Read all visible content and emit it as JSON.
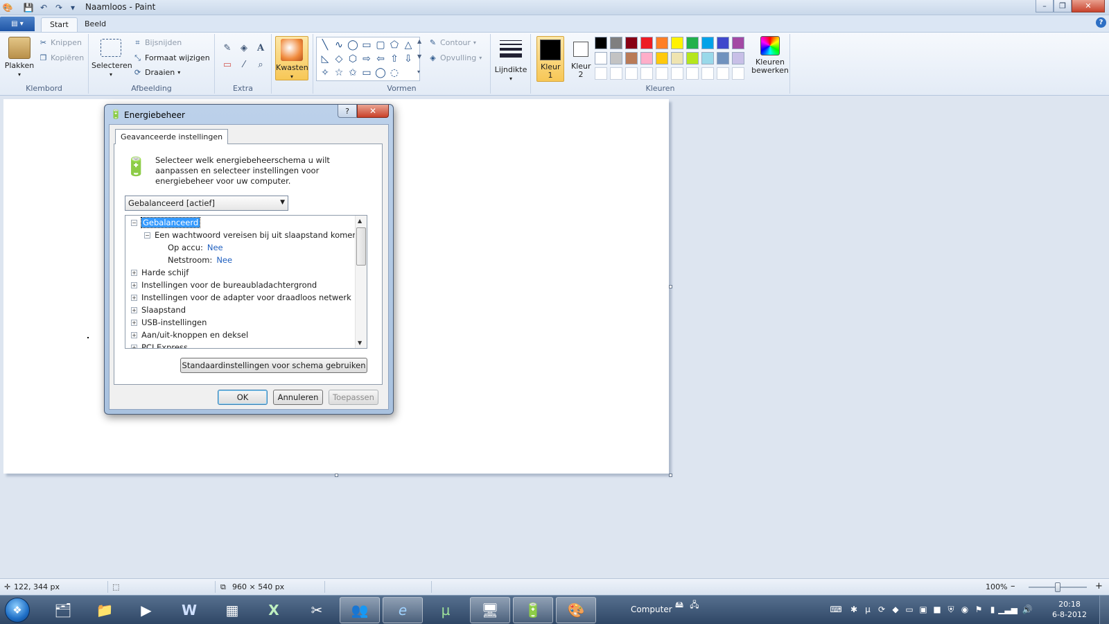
{
  "window": {
    "title": "Naamloos - Paint",
    "min": "–",
    "max": "❐",
    "close": "✕"
  },
  "qat": {
    "save": "💾",
    "undo": "↶",
    "redo": "↷",
    "more": "▾"
  },
  "tabs": {
    "app_menu": "▤ ▾",
    "start": "Start",
    "beeld": "Beeld",
    "help": "?"
  },
  "ribbon": {
    "klembord": {
      "label": "Klembord",
      "paste": "Plakken",
      "cut": "Knippen",
      "copy": "Kopiëren"
    },
    "afbeelding": {
      "label": "Afbeelding",
      "select": "Selecteren",
      "crop": "Bijsnijden",
      "resize": "Formaat wijzigen",
      "rotate": "Draaien"
    },
    "extra": {
      "label": "Extra",
      "pencil": "✎",
      "fill": "◈",
      "text": "A",
      "eraser": "▭",
      "picker": "⁄",
      "magnifier": "⌕"
    },
    "kwasten": {
      "label": "Kwasten"
    },
    "vormen": {
      "label": "Vormen",
      "contour": "Contour",
      "fill": "Opvulling",
      "shapes": [
        "╲",
        "∿",
        "◯",
        "▭",
        "▢",
        "⬠",
        "△",
        "◺",
        "◇",
        "⬡",
        "⇨",
        "⇦",
        "⇧",
        "⇩",
        "✧",
        "☆",
        "✩",
        "▭",
        "◯",
        "◌"
      ]
    },
    "lijndikte": {
      "label": "Lijndikte"
    },
    "kleuren": {
      "label": "Kleuren",
      "color1": "Kleur 1",
      "color2": "Kleur 2",
      "edit": "Kleuren bewerken",
      "palette_row1": [
        "#000000",
        "#7f7f7f",
        "#880015",
        "#ed1c24",
        "#ff7f27",
        "#fff200",
        "#22b14c",
        "#00a2e8",
        "#3f48cc",
        "#a349a4"
      ],
      "palette_row2": [
        "#ffffff",
        "#c3c3c3",
        "#b97a57",
        "#ffaec9",
        "#ffc90e",
        "#efe4b0",
        "#b5e61d",
        "#99d9ea",
        "#7092be",
        "#c8bfe7"
      ],
      "color1_value": "#000000",
      "color2_value": "#ffffff"
    }
  },
  "dialog": {
    "title": "Energiebeheer",
    "help": "?",
    "close": "✕",
    "tab": "Geavanceerde instellingen",
    "intro": "Selecteer welk energiebeheerschema u wilt aanpassen en selecteer instellingen voor energiebeheer voor uw computer.",
    "scheme": "Gebalanceerd [actief]",
    "tree": {
      "root": "Gebalanceerd",
      "password": "Een wachtwoord vereisen bij uit slaapstand komen",
      "on_battery_label": "Op accu:",
      "on_battery_value": "Nee",
      "plugged_label": "Netstroom:",
      "plugged_value": "Nee",
      "items": [
        "Harde schijf",
        "Instellingen voor de bureaubladachtergrond",
        "Instellingen voor de adapter voor draadloos netwerk",
        "Slaapstand",
        "USB-instellingen",
        "Aan/uit-knoppen en deksel",
        "PCI Express"
      ]
    },
    "defaults_button": "Standaardinstellingen voor schema gebruiken",
    "ok": "OK",
    "cancel": "Annuleren",
    "apply": "Toepassen"
  },
  "status": {
    "cursor": "122, 344 px",
    "size": "960 × 540 px",
    "zoom": "100%",
    "zoom_out": "–",
    "zoom_in": "+"
  },
  "taskbar": {
    "computer_label": "Computer",
    "time": "20:18",
    "date": "6-8-2012",
    "apps": [
      "🗂",
      "📁",
      "▶",
      "W",
      "▦",
      "X",
      "✂",
      "👥",
      "e",
      "µ",
      "🖥",
      "🔋",
      "🎨"
    ]
  }
}
